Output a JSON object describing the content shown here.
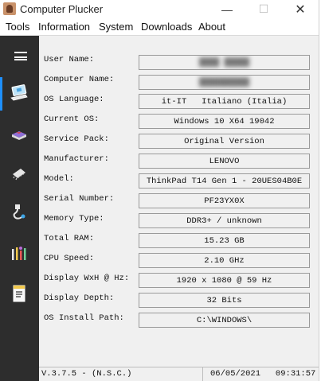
{
  "titlebar": {
    "title": "Computer Plucker",
    "minimize": "—",
    "maximize": "☐",
    "close": "✕"
  },
  "menu": [
    "Tools",
    "Information",
    "System",
    "Downloads",
    "About"
  ],
  "sidebar": {
    "icons": [
      "menu-icon",
      "laptop-icon",
      "disk-drive-icon",
      "memory-chip-icon",
      "usb-icon",
      "tools-icon",
      "report-icon"
    ],
    "accent": "#1e90ff"
  },
  "rows": [
    {
      "label": "User Name:",
      "value": "████ █████",
      "redacted": true
    },
    {
      "label": "Computer Name:",
      "value": "██████████",
      "redacted": true
    },
    {
      "label": "OS Language:",
      "value": "it-IT   Italiano (Italia)"
    },
    {
      "label": "Current OS:",
      "value": "Windows 10 X64 19042"
    },
    {
      "label": "Service Pack:",
      "value": "Original Version"
    },
    {
      "label": "Manufacturer:",
      "value": "LENOVO"
    },
    {
      "label": "Model:",
      "value": "ThinkPad T14 Gen 1 - 20UES04B0E"
    },
    {
      "label": "Serial Number:",
      "value": "PF23YX0X"
    },
    {
      "label": "Memory Type:",
      "value": "DDR3+ / unknown"
    },
    {
      "label": "Total RAM:",
      "value": "15.23 GB"
    },
    {
      "label": "CPU Speed:",
      "value": "2.10 GHz"
    },
    {
      "label": "Display WxH @ Hz:",
      "value": "1920 x 1080 @ 59 Hz"
    },
    {
      "label": "Display Depth:",
      "value": "32 Bits"
    },
    {
      "label": "OS Install Path:",
      "value": "C:\\WINDOWS\\"
    }
  ],
  "status": {
    "version": "V.3.7.5 - (N.S.C.)",
    "datetime": "06/05/2021   09:31:57"
  }
}
